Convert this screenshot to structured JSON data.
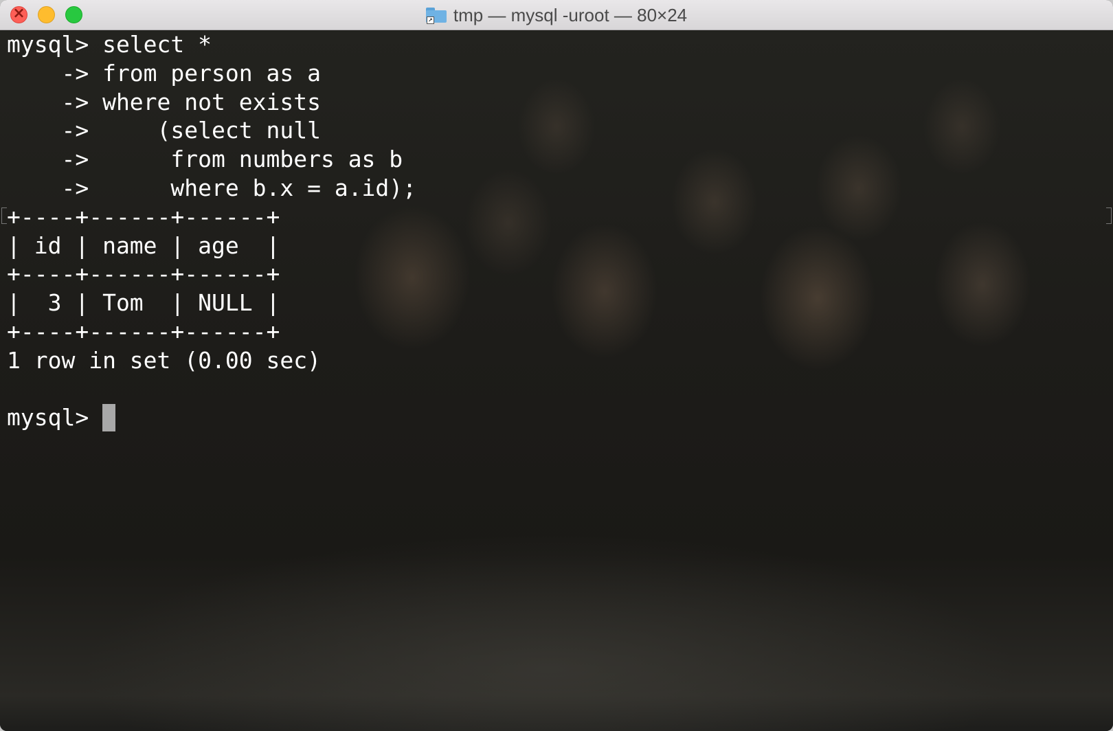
{
  "window": {
    "title": "tmp — mysql -uroot — 80×24"
  },
  "terminal": {
    "lines": [
      "mysql> select *",
      "    -> from person as a",
      "    -> where not exists",
      "    ->     (select null",
      "    ->      from numbers as b",
      "    ->      where b.x = a.id);",
      "+----+------+------+",
      "| id | name | age  |",
      "+----+------+------+",
      "|  3 | Tom  | NULL |",
      "+----+------+------+",
      "1 row in set (0.00 sec)",
      ""
    ],
    "prompt": "mysql> "
  },
  "colors": {
    "text": "#ffffff",
    "cursor": "#a8a8a8",
    "close": "#fd5f57",
    "minimize": "#febc2e",
    "zoom": "#28c840"
  }
}
